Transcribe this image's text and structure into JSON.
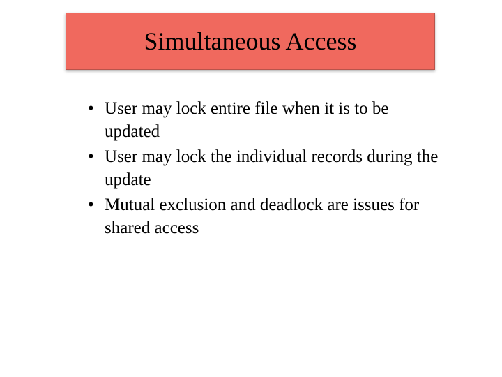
{
  "slide": {
    "title": "Simultaneous Access",
    "bullets": [
      "User may lock entire file when it is to be updated",
      "User may lock the individual records during the update",
      "Mutual exclusion and deadlock are issues for shared access"
    ]
  },
  "colors": {
    "title_bg": "#f0695e",
    "title_border": "#b8544b",
    "text": "#000000"
  }
}
